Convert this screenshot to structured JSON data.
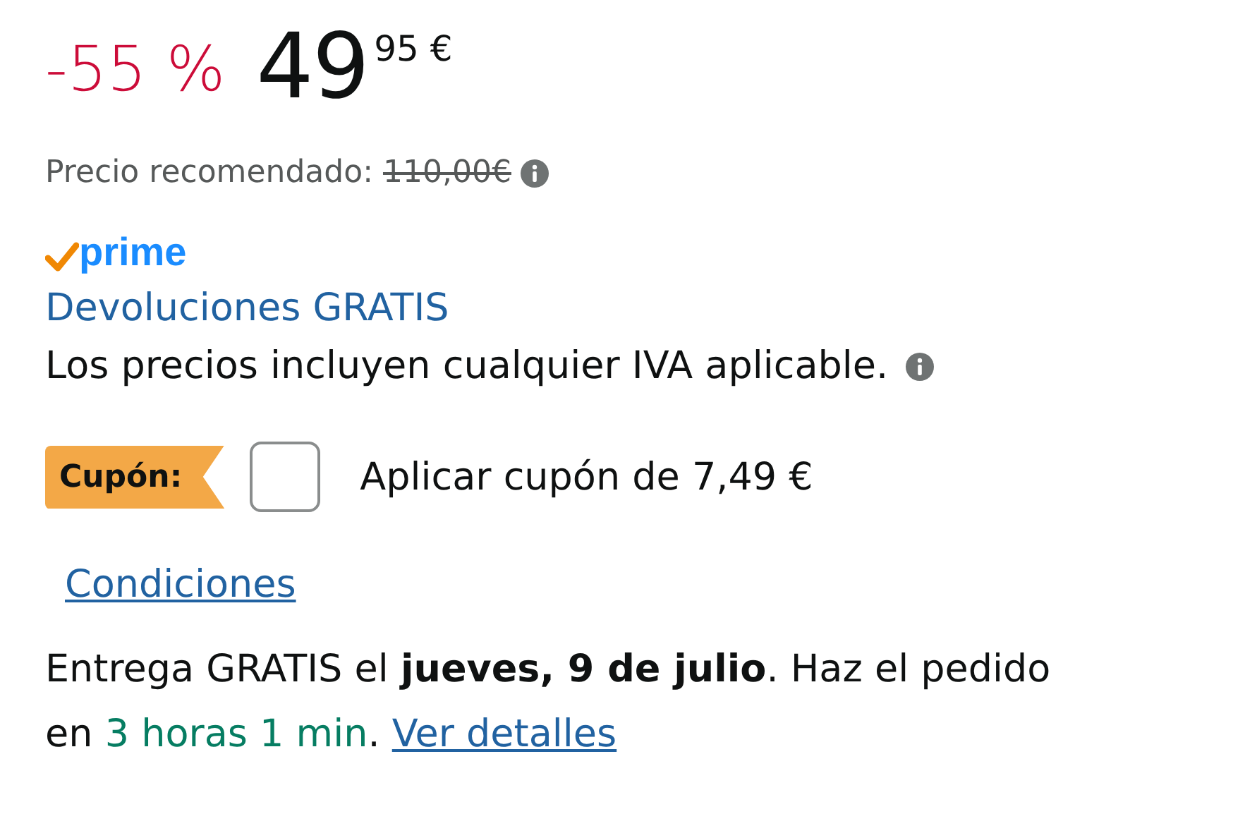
{
  "discount": "-55 %",
  "price": {
    "whole": "49",
    "fraction": "95",
    "currency": "€"
  },
  "list_price": {
    "label": "Precio recomendado:",
    "value": "110,00€",
    "strikethrough": true
  },
  "prime_logo": {
    "text": "prime"
  },
  "returns_link": "Devoluciones GRATIS",
  "tax_note": "Los precios incluyen cualquier IVA aplicable.",
  "coupon": {
    "badge": "Cupón:",
    "checked": false,
    "label": "Aplicar cupón de 7,49 €"
  },
  "conditions_link": "Condiciones",
  "delivery": {
    "lead": "Entrega GRATIS el **jueves, 9 de julio**. Haz el pedido en",
    "countdown": "3 horas 1 min",
    "separator": ".",
    "details_link": "Ver detalles"
  }
}
